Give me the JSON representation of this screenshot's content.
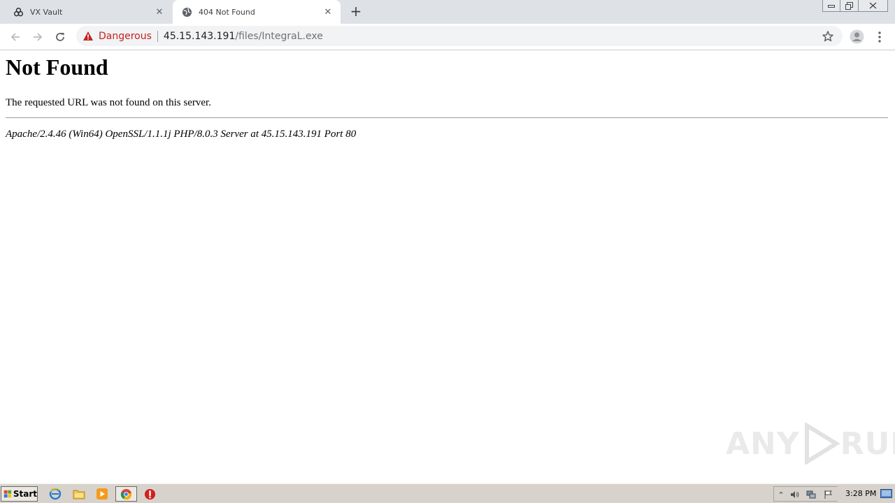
{
  "browser": {
    "tabs": [
      {
        "title": "VX Vault",
        "favicon": "biohazard-icon",
        "active": false
      },
      {
        "title": "404 Not Found",
        "favicon": "globe-icon",
        "active": true
      }
    ],
    "address_bar": {
      "security_label": "Dangerous",
      "url_host": "45.15.143.191",
      "url_path": "/files/IntegraL.exe"
    }
  },
  "page": {
    "heading": "Not Found",
    "message": "The requested URL was not found on this server.",
    "server_signature": "Apache/2.4.46 (Win64) OpenSSL/1.1.1j PHP/8.0.3 Server at 45.15.143.191 Port 80"
  },
  "watermark": {
    "left": "ANY",
    "right": "RUN"
  },
  "taskbar": {
    "start_label": "Start",
    "clock": "3:28 PM"
  },
  "colors": {
    "danger": "#c5221f",
    "tabstrip": "#dee1e6",
    "taskbar": "#d7d3cc"
  }
}
